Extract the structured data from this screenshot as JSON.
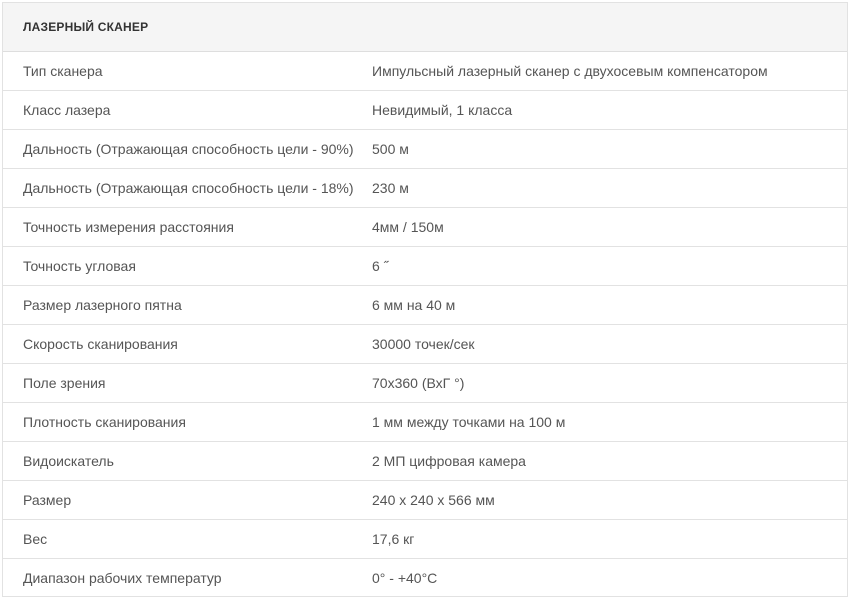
{
  "table": {
    "title": "ЛАЗЕРНЫЙ СКАНЕР",
    "rows": [
      {
        "label": "Тип сканера",
        "value": "Импульсный лазерный сканер с двухосевым компенсатором"
      },
      {
        "label": "Класс лазера",
        "value": "Невидимый, 1 класса"
      },
      {
        "label": "Дальность (Отражающая способность цели - 90%)",
        "value": "500 м"
      },
      {
        "label": "Дальность (Отражающая способность цели - 18%)",
        "value": "230 м"
      },
      {
        "label": "Точность измерения расстояния",
        "value": "4мм / 150м"
      },
      {
        "label": "Точность угловая",
        "value": "6 ˝"
      },
      {
        "label": "Размер лазерного пятна",
        "value": "6 мм на 40 м"
      },
      {
        "label": "Скорость сканирования",
        "value": "30000 точек/сек"
      },
      {
        "label": "Поле зрения",
        "value": "70x360 (ВхГ °)"
      },
      {
        "label": "Плотность сканирования",
        "value": "1 мм между точками на 100 м"
      },
      {
        "label": "Видоискатель",
        "value": "2 МП цифровая камера"
      },
      {
        "label": "Размер",
        "value": "240 x 240 x 566 мм"
      },
      {
        "label": "Вес",
        "value": "17,6 кг"
      },
      {
        "label": "Диапазон рабочих температур",
        "value": "0° - +40°C"
      }
    ]
  }
}
